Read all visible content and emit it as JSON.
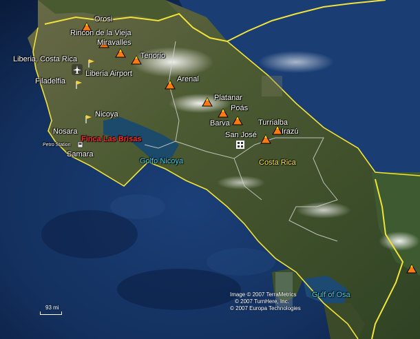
{
  "labels": {
    "orosi": "Orosi",
    "rincon": "Rincon de la Vieja",
    "miravalles": "Miravalles",
    "tenorio": "Tenorio",
    "liberia_cr": "Liberia, Costa Rica",
    "liberia_airport": "Liberia Airport",
    "filadelfia": "Filadelfia",
    "arenal": "Arenal",
    "platanar": "Platanar",
    "poas": "Poás",
    "barva": "Barva",
    "nicoya": "Nicoya",
    "nosara": "Nosara",
    "petro_station": "Petro Station",
    "finca": "Finca Las Brisas",
    "samara": "Samara",
    "golfo_nicoya": "Golfo Nicoya",
    "san_jose": "San José",
    "turrialba": "Turrialba",
    "irazu": "Irazú",
    "costa_rica": "Costa Rica",
    "gulf_osa": "Gulf of Osa"
  },
  "scale": {
    "label": "93 mi"
  },
  "credits": {
    "line1": "Image © 2007 TerraMetrics",
    "line2": "© 2007 TurnHere, Inc.",
    "line3": "© 2007 Europa Technologies"
  },
  "colors": {
    "ocean": "#0e2550",
    "land": "#4e5a35",
    "border": "#f2e33a",
    "province": "#d0d0d0",
    "volcano": "#ff7a12"
  },
  "icons": {
    "volcano": "volcano-icon",
    "pin": "yellow-pushpin-icon",
    "airport": "airport-icon",
    "station": "gas-station-icon",
    "city": "city-icon"
  }
}
